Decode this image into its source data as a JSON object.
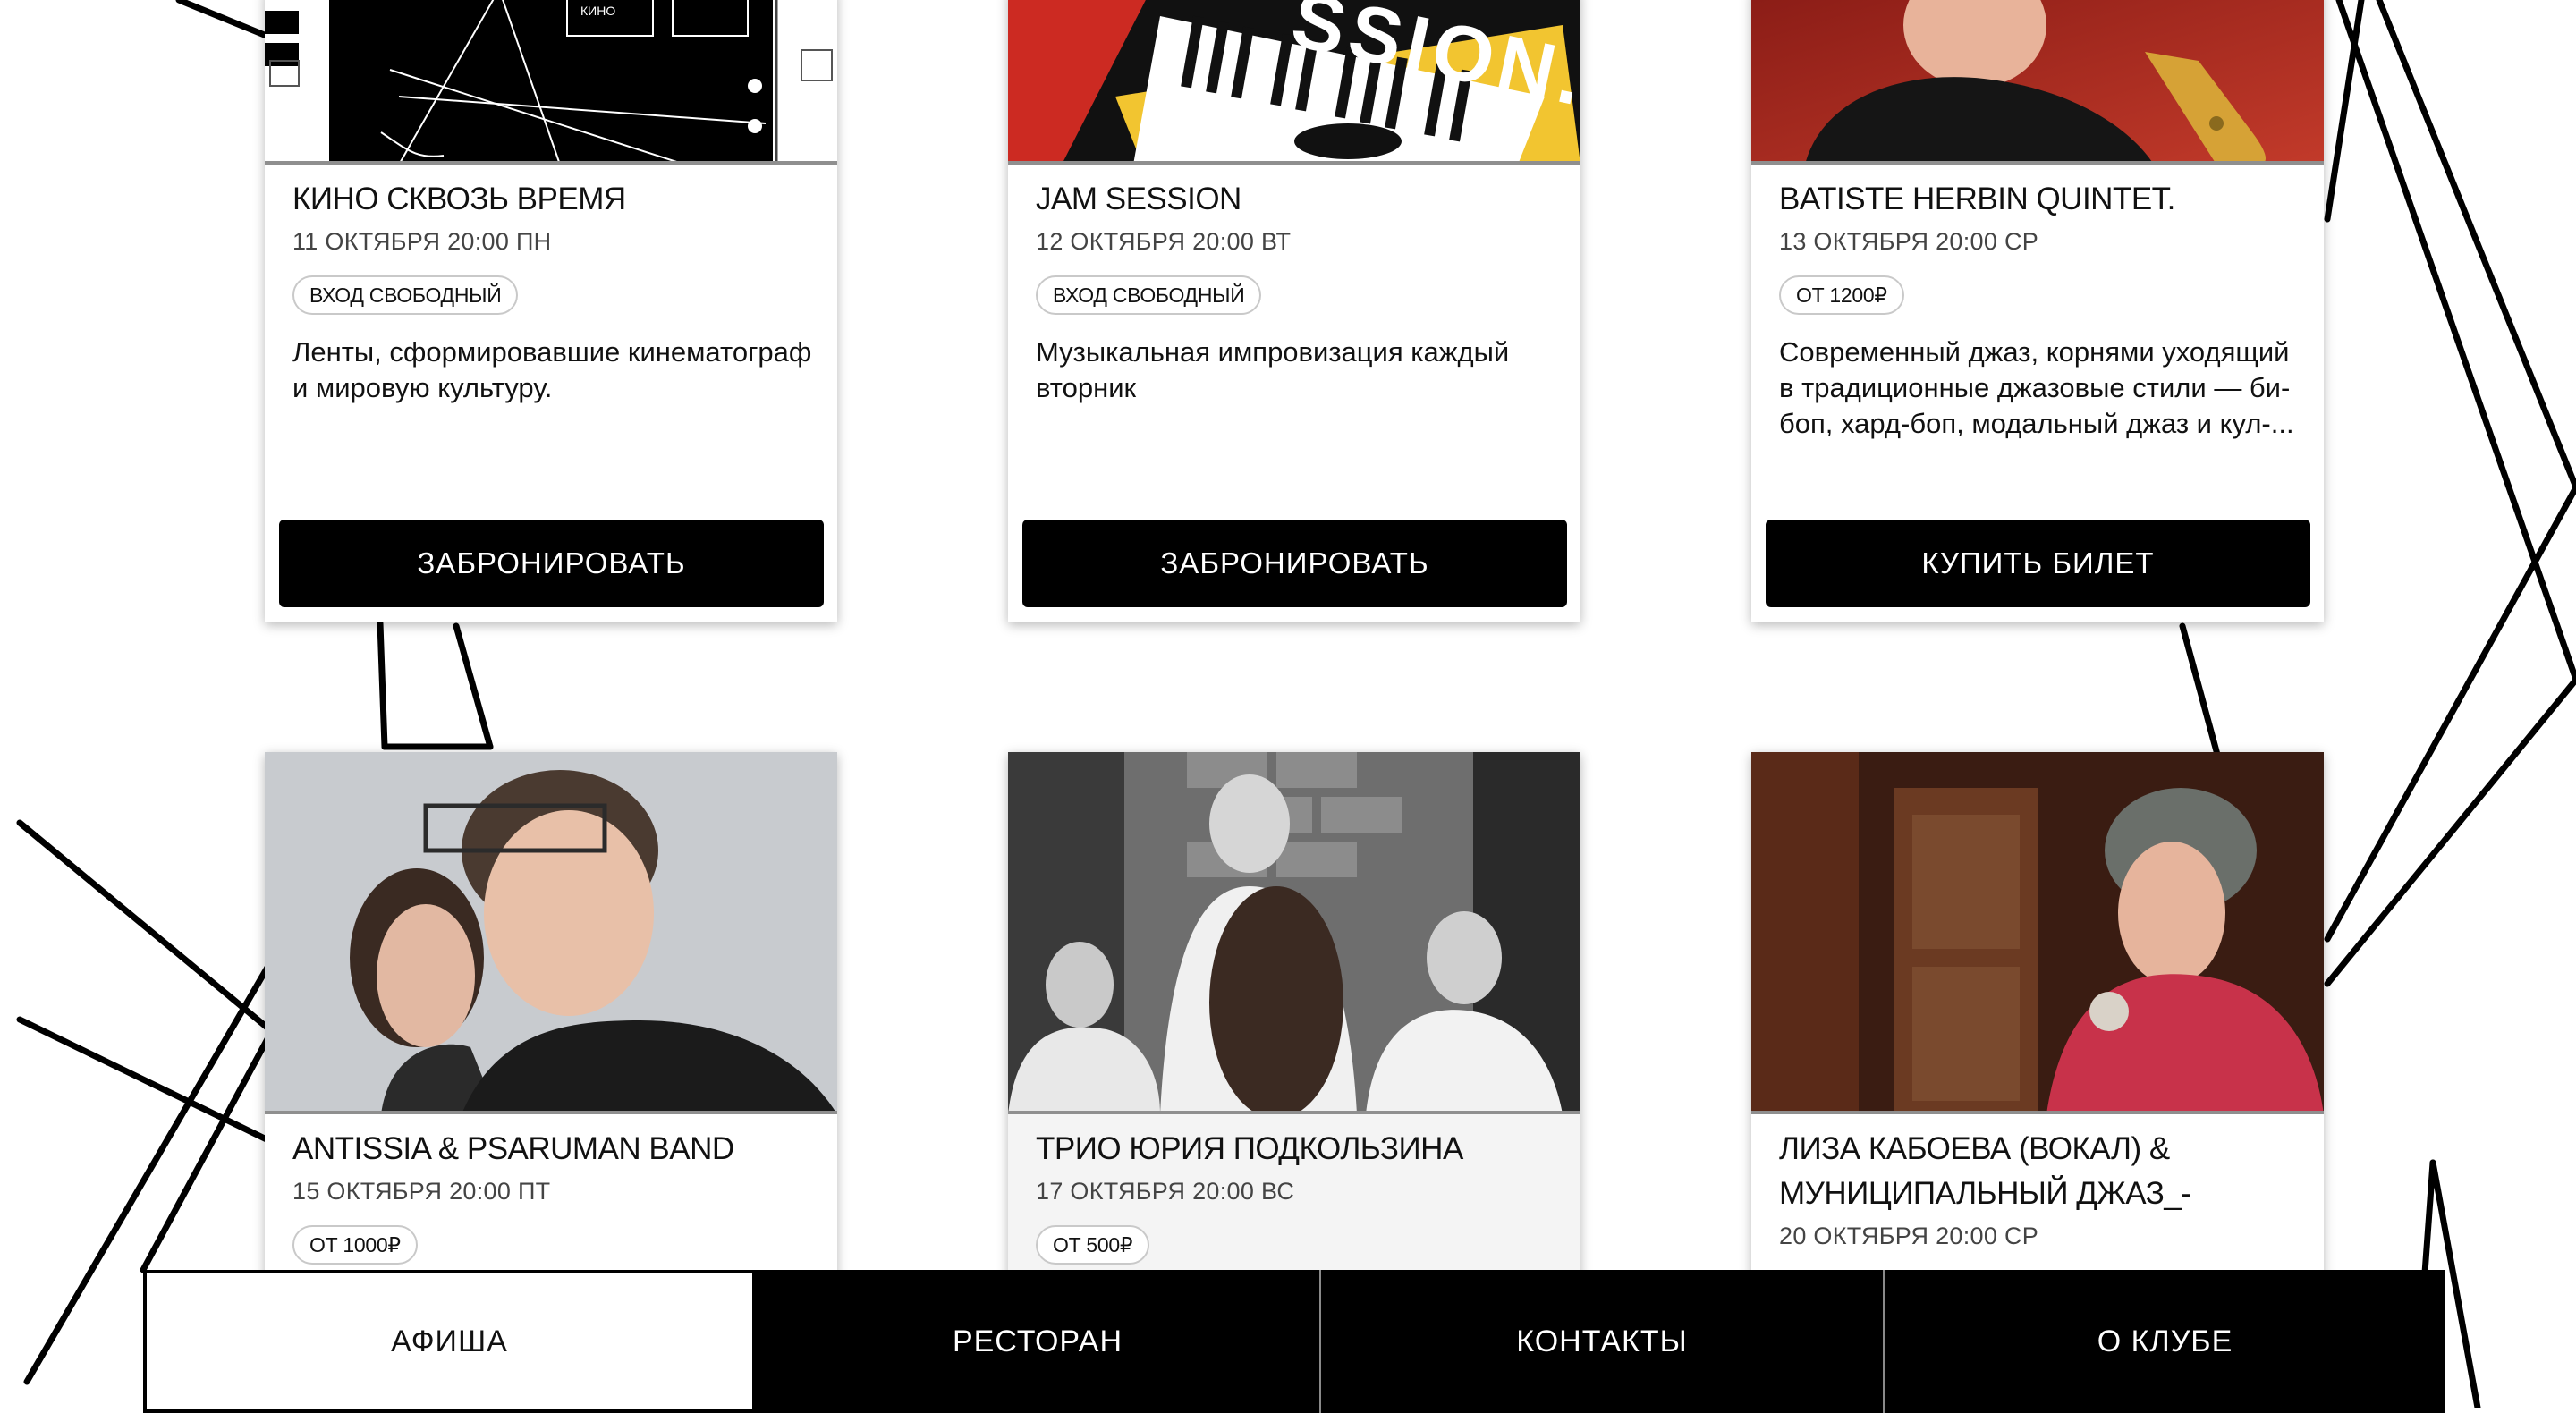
{
  "events": [
    {
      "title": "КИНО СКВОЗЬ ВРЕМЯ",
      "date": "11 ОКТЯБРЯ 20:00 ПН",
      "badge": "ВХОД СВОБОДНЫЙ",
      "description": "Ленты, сформировавшие кинематограф и мировую культуру.",
      "button": "ЗАБРОНИРОВАТЬ",
      "image_text": "КИНО"
    },
    {
      "title": "JAM SESSION",
      "date": "12 ОКТЯБРЯ 20:00 ВТ",
      "badge": "ВХОД СВОБОДНЫЙ",
      "description": "Музыкальная импровизация каждый вторник",
      "button": "ЗАБРОНИРОВАТЬ",
      "image_text": "SSION."
    },
    {
      "title": "BATISTE HERBIN QUINTET.",
      "date": "13 ОКТЯБРЯ 20:00 СР",
      "badge": "ОТ 1200₽",
      "description": "Современный джаз, корнями уходящий в традиционные джазовые стили — би-боп, хард-боп, модальный джаз и кул-...",
      "button": "КУПИТЬ БИЛЕТ"
    },
    {
      "title": "ANTISSIA & PSARUMAN BAND",
      "date": "15 ОКТЯБРЯ 20:00 ПТ",
      "badge": "ОТ 1000₽"
    },
    {
      "title": "ТРИО ЮРИЯ ПОДКОЛЬЗИНА",
      "date": "17 ОКТЯБРЯ 20:00 ВС",
      "badge": "ОТ 500₽"
    },
    {
      "title": "ЛИЗА КАБОЕВА (ВОКАЛ) & МУНИЦИПАЛЬНЫЙ ДЖАЗ_-",
      "date": "20 ОКТЯБРЯ 20:00 СР"
    }
  ],
  "nav": {
    "tabs": [
      {
        "label": "АФИША",
        "active": true
      },
      {
        "label": "РЕСТОРАН",
        "active": false
      },
      {
        "label": "КОНТАКТЫ",
        "active": false
      },
      {
        "label": "О КЛУБЕ",
        "active": false
      }
    ]
  },
  "colors": {
    "button_bg": "#000000",
    "nav_bg": "#000000",
    "card_bg": "#ffffff",
    "accent_red": "#cc2a22",
    "accent_yellow": "#f2c530"
  }
}
